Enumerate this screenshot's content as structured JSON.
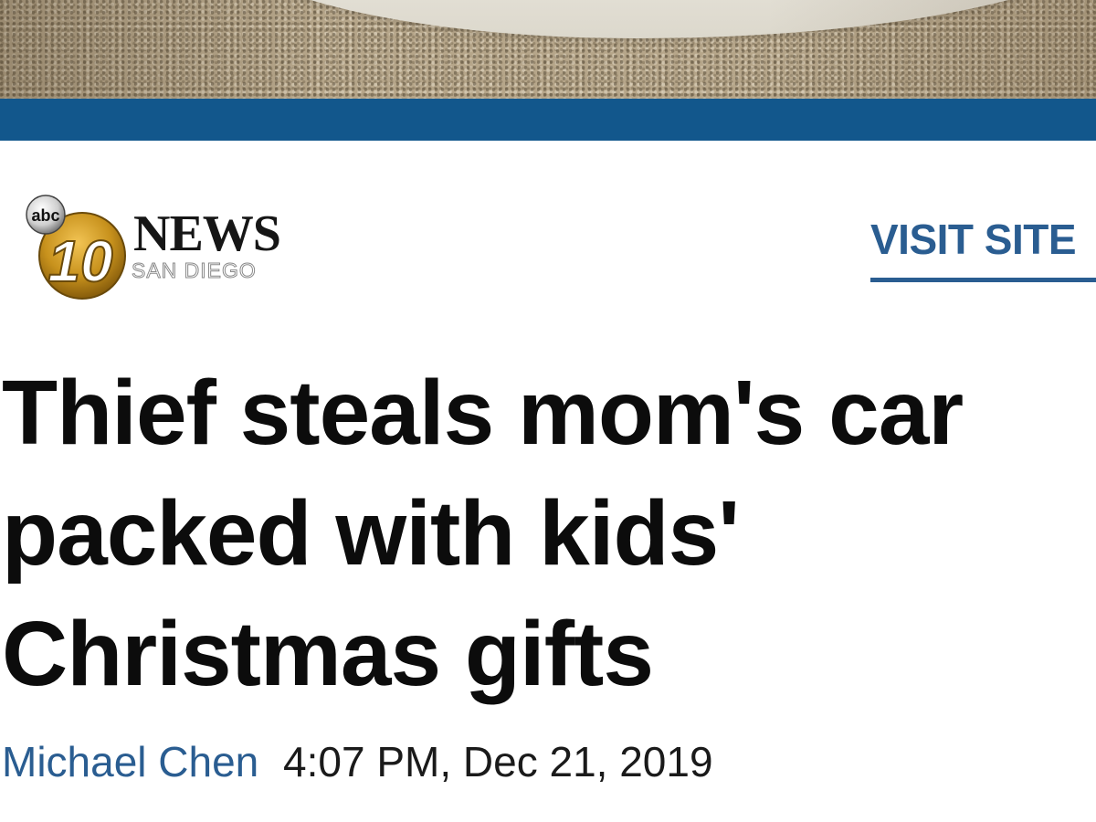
{
  "logo": {
    "network": "abc",
    "channel_number": "10",
    "brand": "NEWS",
    "city": "SAN DIEGO"
  },
  "header": {
    "visit_site_label": "VISIT SITE"
  },
  "article": {
    "title": "Thief steals mom's car packed with kids' Christmas gifts",
    "author": "Michael Chen",
    "timestamp": "4:07 PM, Dec 21, 2019"
  },
  "colors": {
    "brand_blue": "#12578c",
    "link_blue": "#2a5d91",
    "logo_gold": "#c8921d"
  }
}
